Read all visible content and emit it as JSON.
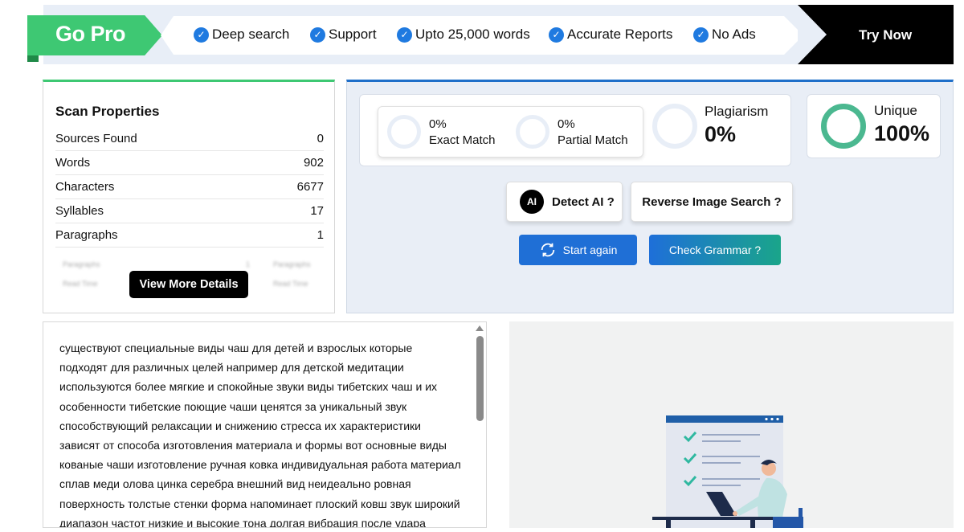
{
  "banner": {
    "gopro_label": "Go Pro",
    "features": [
      "Deep search",
      "Support",
      "Upto 25,000 words",
      "Accurate Reports",
      "No Ads"
    ],
    "try_now_label": "Try Now",
    "accent_green": "#3ec873",
    "check_color": "#1f7ae0"
  },
  "scan": {
    "title": "Scan Properties",
    "rows": [
      {
        "label": "Sources Found",
        "value": "0"
      },
      {
        "label": "Words",
        "value": "902"
      },
      {
        "label": "Characters",
        "value": "6677"
      },
      {
        "label": "Syllables",
        "value": "17"
      },
      {
        "label": "Paragraphs",
        "value": "1"
      }
    ],
    "blurred": [
      "Paragraphs",
      "1",
      "Paragraphs",
      "Read Time",
      "Read Time"
    ],
    "view_more_label": "View More Details"
  },
  "results": {
    "exact_pct": "0%",
    "exact_label": "Exact Match",
    "partial_pct": "0%",
    "partial_label": "Partial Match",
    "plagiarism_label": "Plagiarism",
    "plagiarism_value": "0%",
    "unique_label": "Unique",
    "unique_value": "100%",
    "unique_color": "#4bb890"
  },
  "actions": {
    "detect_ai_icon_text": "AI",
    "detect_ai_label": "Detect AI ?",
    "reverse_image_label": "Reverse Image Search ?",
    "start_again_label": "Start again",
    "check_grammar_label": "Check Grammar ?",
    "start_color": "#1f6fd6",
    "grammar_color": "#1aa58a"
  },
  "input_text": "существуют специальные виды чаш для детей и взрослых которые подходят для различных целей например для детской медитации используются более мягкие и спокойные звуки виды тибетских чаш и их особенности тибетские поющие чаши ценятся за уникальный звук способствующий релаксации и снижению стресса их характеристики зависят от способа изготовления материала и формы вот основные виды кованые чаши изготовление ручная ковка индивидуальная работа материал сплав меди олова цинка серебра внешний вид неидеально ровная поверхность толстые стенки форма напоминает плоский ковш звук широкий диапазон частот низкие и высокие тона долгая вибрация после удара глубокий объемный гул расслабляющий"
}
